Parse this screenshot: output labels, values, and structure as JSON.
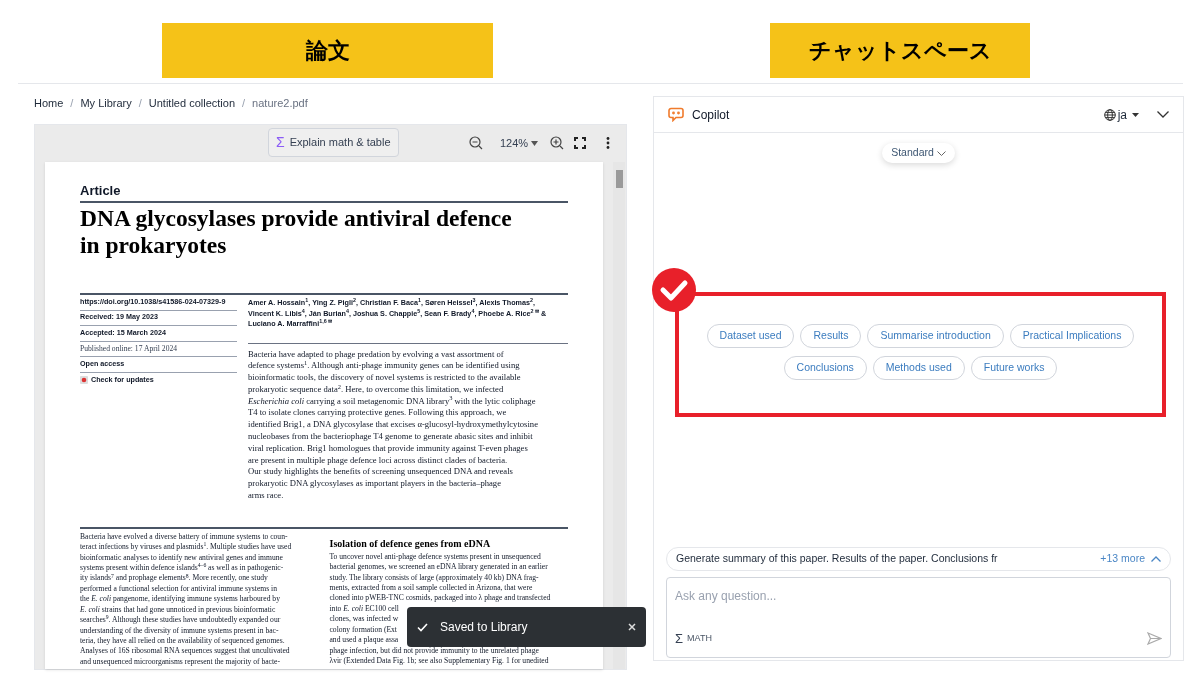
{
  "annotations": [
    {
      "label": "論文"
    },
    {
      "label": "チャットスペース"
    }
  ],
  "breadcrumb": [
    {
      "kind": "link",
      "text": "Home"
    },
    {
      "kind": "separator",
      "text": "/"
    },
    {
      "kind": "link",
      "text": "My Library"
    },
    {
      "kind": "separator",
      "text": "/"
    },
    {
      "kind": "link",
      "text": "Untitled collection"
    },
    {
      "kind": "separator",
      "text": "/"
    },
    {
      "kind": "current",
      "text": "nature2.pdf"
    }
  ],
  "viewer_toolbar": {
    "explain_icon": "Σ",
    "explain_button": "Explain math & table",
    "zoom": "124%"
  },
  "document": {
    "label": "Article",
    "title": [
      "DNA glycosylases provide antiviral defence",
      "in prokaryotes"
    ],
    "meta": [
      {
        "kind": "bold",
        "text": "https://doi.org/10.1038/s41586-024-07329-9"
      },
      {
        "kind": "bold",
        "text": "Received: 19 May 2023"
      },
      {
        "kind": "bold",
        "text": "Accepted: 15 March 2024"
      },
      {
        "kind": "serif",
        "text": "Published online: 17 April 2024"
      },
      {
        "kind": "bold",
        "text": "Open access"
      },
      {
        "kind": "check",
        "text": "Check for updates"
      }
    ],
    "authors": [
      "Amer A. Hossain$^{1}$, Ying Z. Pigli$^{2}$, Christian F. Baca$^{1}$, Søren Heissel$^{3}$, Alexis Thomas$^{2}$,",
      "Vincent K. Libis$^{4}$, Ján Burian$^{4}$, Joshua S. Chappie$^{5}$, Sean F. Brady$^{4}$, Phoebe A. Rice$^{2 ✉}$ &",
      "Luciano A. Marraffini$^{1,6 ✉}$"
    ],
    "abstract": [
      "Bacteria have adapted to phage predation by evolving a vast assortment of",
      "defence systems$^{1}$. Although anti-phage immunity genes can be identified using",
      "bioinformatic tools, the discovery of novel systems is restricted to the available",
      "prokaryotic sequence data$^{2}$. Here, to overcome this limitation, we infected",
      "*Escherichia coli* carrying a soil metagenomic DNA library$^{3}$ with the lytic coliphage",
      "T4 to isolate clones carrying protective genes. Following this approach, we",
      "identified Brig1, a DNA glycosylase that excises α-glucosyl-hydroxymethylcytosine",
      "nucleobases from the bacteriophage T4 genome to generate abasic sites and inhibit",
      "viral replication. Brig1 homologues that provide immunity against T-even phages",
      "are present in multiple phage defence loci across distinct clades of bacteria.",
      "Our study highlights the benefits of screening unsequenced DNA and reveals",
      "prokaryotic DNA glycosylases as important players in the bacteria–phage",
      "arms race."
    ],
    "body_left": [
      "Bacteria have evolved a diverse battery of immune systems to coun-",
      "teract infections by viruses and plasmids$^{1}$. Multiple studies have used",
      "bioinformatic analyses to identify new antiviral genes and immune",
      "systems present within defence islands$^{4–6}$ as well as in pathogenic-",
      "ity islands$^{7}$ and prophage elements$^{8}$. More recently, one study",
      "performed a functional selection for antiviral immune systems in",
      "the *E. coli* pangenome, identifying immune systems harboured by",
      "*E. coli* strains that had gone unnoticed in previous bioinformatic",
      "searches$^{9}$. Although these studies have undoubtedly expanded our",
      "understanding of the diversity of immune systems present in bac-",
      "teria, they have all relied on the availability of sequenced genomes.",
      "Analyses of 16S ribosomal RNA sequences suggest that uncultivated",
      "and unsequenced microorganisms represent the majority of bacte-"
    ],
    "section_heading": "Isolation of defence genes from eDNA",
    "body_right": [
      "To uncover novel anti-phage defence systems present in unsequenced",
      "bacterial genomes, we screened an eDNA library generated in an earlier",
      "study. The library consists of large (approximately 40 kb) DNA frag-",
      "ments, extracted from a soil sample collected in Arizona, that were",
      "cloned into pWEB-TNC cosmids, packaged into λ phage and transfected",
      "into *E. coli* EC100 cell",
      "clones, was infected w",
      "colony formation (Ext",
      "and used a plaque assa",
      "phage infection, but did not provide immunity to the unrelated phage",
      "λvir (Extended Data Fig. 1b; see also Supplementary Fig. 1 for unedited"
    ]
  },
  "toast": {
    "text": "Saved to Library"
  },
  "copilot": {
    "title": "Copilot",
    "language": "ja",
    "mode": "Standard",
    "chips": [
      {
        "label": "Dataset used"
      },
      {
        "label": "Results"
      },
      {
        "label": "Summarise introduction"
      },
      {
        "label": "Practical Implications"
      },
      {
        "label": "Conclusions"
      },
      {
        "label": "Methods used"
      },
      {
        "label": "Future works"
      }
    ],
    "suggestion": {
      "text": "Generate summary of this paper. Results of the paper. Conclusions fr",
      "more": "+13 more"
    },
    "input": {
      "placeholder": "Ask any question...",
      "math_icon": "Σ",
      "math_label": "MATH"
    }
  }
}
